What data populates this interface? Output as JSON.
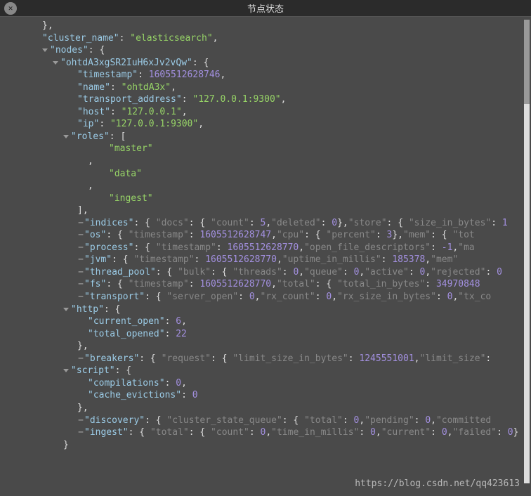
{
  "ui": {
    "title": "节点状态",
    "close": "✕",
    "watermark": "https://blog.csdn.net/qq423613"
  },
  "cluster_name": "elasticsearch",
  "node_id": "ohtdA3xgSR2IuH6xJv2vQw",
  "timestamp": 1605512628746,
  "name": "ohtdA3x",
  "transport_address": "127.0.0.1:9300",
  "host": "127.0.0.1",
  "ip": "127.0.0.1:9300",
  "roles": [
    "master",
    "data",
    "ingest"
  ],
  "indices": {
    "docs": {
      "count": 5,
      "deleted": 0
    },
    "store": {
      "size_in_bytes": 1
    }
  },
  "os": {
    "timestamp": 1605512628747,
    "cpu": {
      "percent": 3
    }
  },
  "process": {
    "timestamp": 1605512628770,
    "open_file_descriptors": -1
  },
  "jvm": {
    "timestamp": 1605512628770,
    "uptime_in_millis": 185378
  },
  "thread_pool": {
    "bulk": {
      "threads": 0,
      "queue": 0,
      "active": 0,
      "rejected": 0
    }
  },
  "fs": {
    "timestamp": 1605512628770,
    "total": {
      "total_in_bytes": 34970848
    }
  },
  "transport": {
    "server_open": 0,
    "rx_count": 0,
    "rx_size_in_bytes": 0
  },
  "http": {
    "current_open": 6,
    "total_opened": 22
  },
  "breakers": {
    "request": {
      "limit_size_in_bytes": 1245551001
    }
  },
  "script": {
    "compilations": 0,
    "cache_evictions": 0
  },
  "discovery": {
    "cluster_state_queue": {
      "total": 0,
      "pending": 0
    }
  },
  "ingest": {
    "total": {
      "count": 0,
      "time_in_millis": 0,
      "current": 0,
      "failed": 0
    }
  },
  "chart_data": null
}
